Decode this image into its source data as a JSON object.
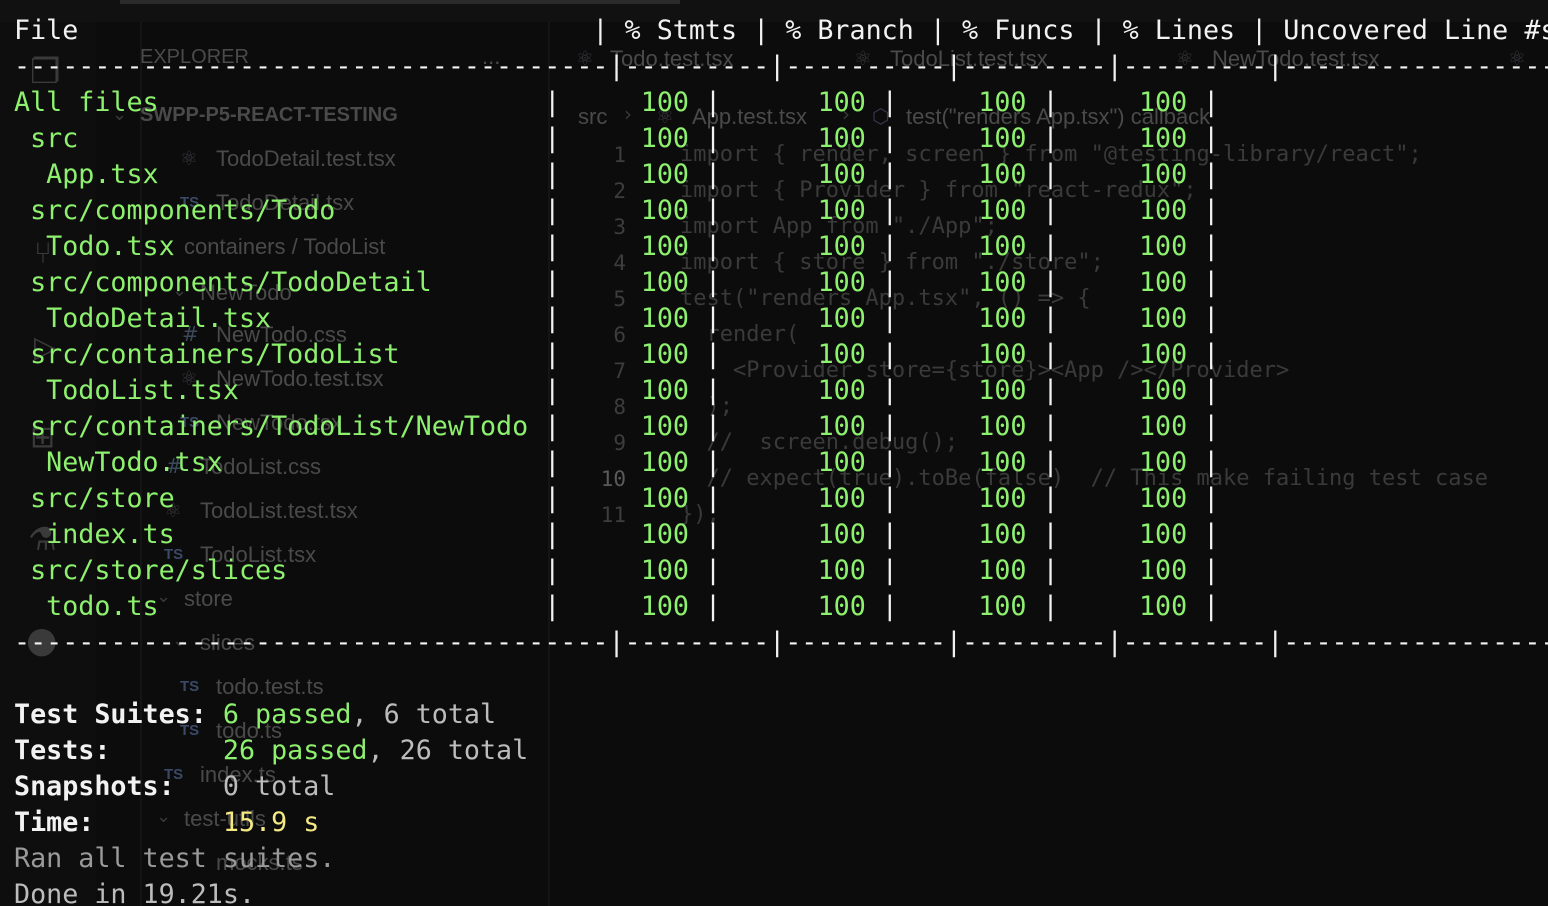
{
  "background_editor": {
    "explorer_title": "EXPLORER",
    "explorer_more": "...",
    "project_name": "SWPP-P5-REACT-TESTING",
    "tabs": [
      "Todo.test.tsx",
      "TodoList.test.tsx",
      "NewTodo.test.tsx"
    ],
    "breadcrumb": {
      "folder": "src",
      "file": "App.test.tsx",
      "symbol": "test(\"renders App.tsx\") callback"
    },
    "tree": [
      {
        "label": "TodoDetail.test.tsx",
        "kind": "react"
      },
      {
        "label": "TodoDetail.tsx",
        "kind": "ts"
      },
      {
        "label": "containers / TodoList",
        "kind": "folder"
      },
      {
        "label": "NewTodo",
        "kind": "folder"
      },
      {
        "label": "NewTodo.css",
        "kind": "css"
      },
      {
        "label": "NewTodo.test.tsx",
        "kind": "react"
      },
      {
        "label": "NewTodo.tsx",
        "kind": "ts"
      },
      {
        "label": "TodoList.css",
        "kind": "css"
      },
      {
        "label": "TodoList.test.tsx",
        "kind": "react"
      },
      {
        "label": "TodoList.tsx",
        "kind": "ts"
      },
      {
        "label": "store",
        "kind": "folder"
      },
      {
        "label": "slices",
        "kind": "folder"
      },
      {
        "label": "todo.test.ts",
        "kind": "ts"
      },
      {
        "label": "todo.ts",
        "kind": "ts"
      },
      {
        "label": "index.ts",
        "kind": "ts"
      },
      {
        "label": "test-utils",
        "kind": "folder"
      },
      {
        "label": "mocks.ts",
        "kind": "ts"
      }
    ],
    "code_lines": [
      {
        "num": "1",
        "text": "import { render, screen } from \"@testing-library/react\";"
      },
      {
        "num": "2",
        "text": "import { Provider } from \"react-redux\";"
      },
      {
        "num": "3",
        "text": "import App from \"./App\";"
      },
      {
        "num": "4",
        "text": "import { store } from \"./store\";"
      },
      {
        "num": "5",
        "text": "test(\"renders App.tsx\", () => {"
      },
      {
        "num": "6",
        "text": "  render("
      },
      {
        "num": "7",
        "text": "    <Provider store={store}><App /></Provider>"
      },
      {
        "num": "8",
        "text": "  );"
      },
      {
        "num": "9",
        "text": "  //  screen.debug();"
      },
      {
        "num": "10",
        "text": "  // expect(true).toBe(false)  // This make failing test case"
      },
      {
        "num": "11",
        "text": "});"
      }
    ]
  },
  "coverage": {
    "header": "File                                | % Stmts | % Branch | % Funcs | % Lines | Uncovered Line #s",
    "separator": "-------------------------------------|---------|----------|---------|---------|-------------------",
    "rows": [
      {
        "file": "All files",
        "stmts": "100",
        "branch": "100",
        "funcs": "100",
        "lines": "100",
        "uncovered": ""
      },
      {
        "file": " src",
        "stmts": "100",
        "branch": "100",
        "funcs": "100",
        "lines": "100",
        "uncovered": ""
      },
      {
        "file": "  App.tsx",
        "stmts": "100",
        "branch": "100",
        "funcs": "100",
        "lines": "100",
        "uncovered": ""
      },
      {
        "file": " src/components/Todo",
        "stmts": "100",
        "branch": "100",
        "funcs": "100",
        "lines": "100",
        "uncovered": ""
      },
      {
        "file": "  Todo.tsx",
        "stmts": "100",
        "branch": "100",
        "funcs": "100",
        "lines": "100",
        "uncovered": ""
      },
      {
        "file": " src/components/TodoDetail",
        "stmts": "100",
        "branch": "100",
        "funcs": "100",
        "lines": "100",
        "uncovered": ""
      },
      {
        "file": "  TodoDetail.tsx",
        "stmts": "100",
        "branch": "100",
        "funcs": "100",
        "lines": "100",
        "uncovered": ""
      },
      {
        "file": " src/containers/TodoList",
        "stmts": "100",
        "branch": "100",
        "funcs": "100",
        "lines": "100",
        "uncovered": ""
      },
      {
        "file": "  TodoList.tsx",
        "stmts": "100",
        "branch": "100",
        "funcs": "100",
        "lines": "100",
        "uncovered": ""
      },
      {
        "file": " src/containers/TodoList/NewTodo",
        "stmts": "100",
        "branch": "100",
        "funcs": "100",
        "lines": "100",
        "uncovered": ""
      },
      {
        "file": "  NewTodo.tsx",
        "stmts": "100",
        "branch": "100",
        "funcs": "100",
        "lines": "100",
        "uncovered": ""
      },
      {
        "file": " src/store",
        "stmts": "100",
        "branch": "100",
        "funcs": "100",
        "lines": "100",
        "uncovered": ""
      },
      {
        "file": "  index.ts",
        "stmts": "100",
        "branch": "100",
        "funcs": "100",
        "lines": "100",
        "uncovered": ""
      },
      {
        "file": " src/store/slices",
        "stmts": "100",
        "branch": "100",
        "funcs": "100",
        "lines": "100",
        "uncovered": ""
      },
      {
        "file": "  todo.ts",
        "stmts": "100",
        "branch": "100",
        "funcs": "100",
        "lines": "100",
        "uncovered": ""
      }
    ]
  },
  "summary": {
    "suites_label": "Test Suites:",
    "suites_passed": "6 passed",
    "suites_total": ", 6 total",
    "tests_label": "Tests:",
    "tests_passed": "26 passed",
    "tests_total": ", 26 total",
    "snapshots_label": "Snapshots:",
    "snapshots_value": "0 total",
    "time_label": "Time:",
    "time_value": "15.9 s",
    "ran_all": "Ran all test suites.",
    "done": "Done in 19.21s."
  },
  "colors": {
    "terminal_bg": "#0c0c0c",
    "pass_green": "#8ef06f",
    "time_yellow": "#f4e983",
    "text_white": "#f2f2f2"
  }
}
